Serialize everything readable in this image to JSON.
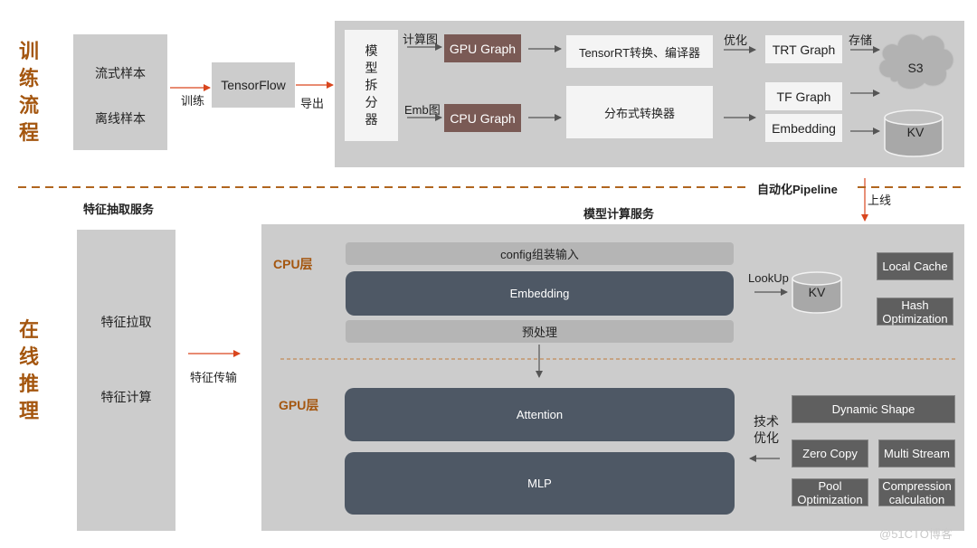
{
  "training": {
    "side_title": [
      "训",
      "练",
      "流",
      "程"
    ],
    "samples": [
      "流式样本",
      "离线样本"
    ],
    "train_label": "训练",
    "tensorflow": "TensorFlow",
    "export_label": "导出",
    "splitter": [
      "模",
      "型",
      "拆",
      "分",
      "器"
    ],
    "compute_graph_label": "计算图",
    "emb_graph_label": "Emb图",
    "gpu_graph": "GPU Graph",
    "cpu_graph": "CPU Graph",
    "tensorrt": "TensorRT转换、编译器",
    "distributed": "分布式转换器",
    "optimize_label": "优化",
    "trt_graph": "TRT Graph",
    "tf_graph": "TF Graph",
    "embedding": "Embedding",
    "store_label": "存储",
    "s3": "S3",
    "kv": "KV"
  },
  "divider": {
    "pipeline_label": "自动化Pipeline",
    "deploy_label": "上线"
  },
  "inference": {
    "side_title": [
      "在",
      "线",
      "推",
      "理"
    ],
    "feature_service_title": "特征抽取服务",
    "feature_items": [
      "特征拉取",
      "特征计算"
    ],
    "feature_transfer_label": "特征传输",
    "model_service_title": "模型计算服务",
    "cpu_layer": {
      "label": "CPU层",
      "config_input": "config组装输入",
      "embedding": "Embedding",
      "preprocess": "预处理",
      "lookup_label": "LookUp",
      "kv": "KV",
      "local_cache": "Local Cache",
      "hash_optimization": [
        "Hash",
        "Optimization"
      ]
    },
    "gpu_layer": {
      "label": "GPU层",
      "attention": "Attention",
      "mlp": "MLP",
      "tech_opt_label": [
        "技术",
        "优化"
      ],
      "dynamic_shape": "Dynamic Shape",
      "zero_copy": "Zero Copy",
      "multi_stream": "Multi Stream",
      "pool_optimization": [
        "Pool",
        "Optimization"
      ],
      "compression_calculation": [
        "Compression",
        "calculation"
      ]
    }
  },
  "watermark": "@51CTO博客",
  "colors": {
    "accent": "#a4560f",
    "arrow_red": "#d9461e",
    "graph_brown": "#7a5a55",
    "layer_dark": "#4e5865"
  }
}
